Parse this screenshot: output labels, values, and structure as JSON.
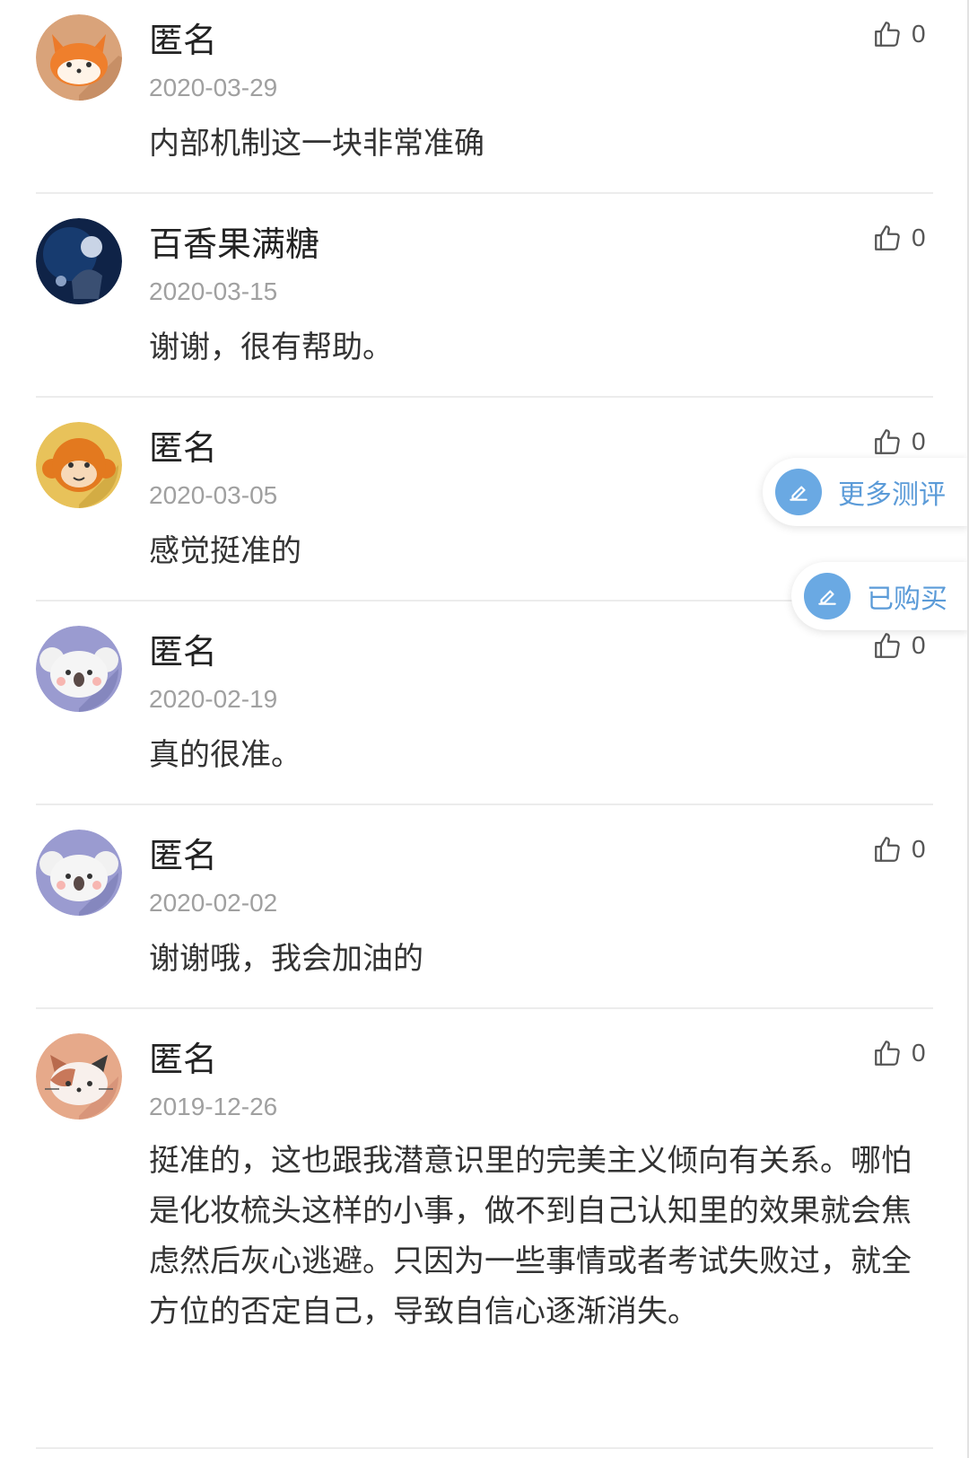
{
  "comments": [
    {
      "name": "匿名",
      "date": "2020-03-29",
      "text": "内部机制这一块非常准确",
      "likes": "0",
      "avatar": "fox-avatar"
    },
    {
      "name": "百香果满糖",
      "date": "2020-03-15",
      "text": "谢谢，很有帮助。",
      "likes": "0",
      "avatar": "photo-avatar"
    },
    {
      "name": "匿名",
      "date": "2020-03-05",
      "text": "感觉挺准的",
      "likes": "0",
      "avatar": "monkey-avatar"
    },
    {
      "name": "匿名",
      "date": "2020-02-19",
      "text": "真的很准。",
      "likes": "0",
      "avatar": "koala-avatar"
    },
    {
      "name": "匿名",
      "date": "2020-02-02",
      "text": "谢谢哦，我会加油的",
      "likes": "0",
      "avatar": "koala-avatar"
    },
    {
      "name": "匿名",
      "date": "2019-12-26",
      "text": "挺准的，这也跟我潜意识里的完美主义倾向有关系。哪怕是化妆梳头这样的小事，做不到自己认知里的效果就会焦虑然后灰心逃避。只因为一些事情或者考试失败过，就全方位的否定自己，导致自信心逐渐消失。",
      "likes": "0",
      "avatar": "cat-avatar"
    }
  ],
  "floating": {
    "more_reviews": "更多测评",
    "purchased": "已购买"
  },
  "icons": {
    "like": "thumbs-up-icon",
    "edit": "pencil-icon"
  },
  "colors": {
    "accent": "#6aa9e3",
    "accent_text": "#5b9bd8"
  }
}
